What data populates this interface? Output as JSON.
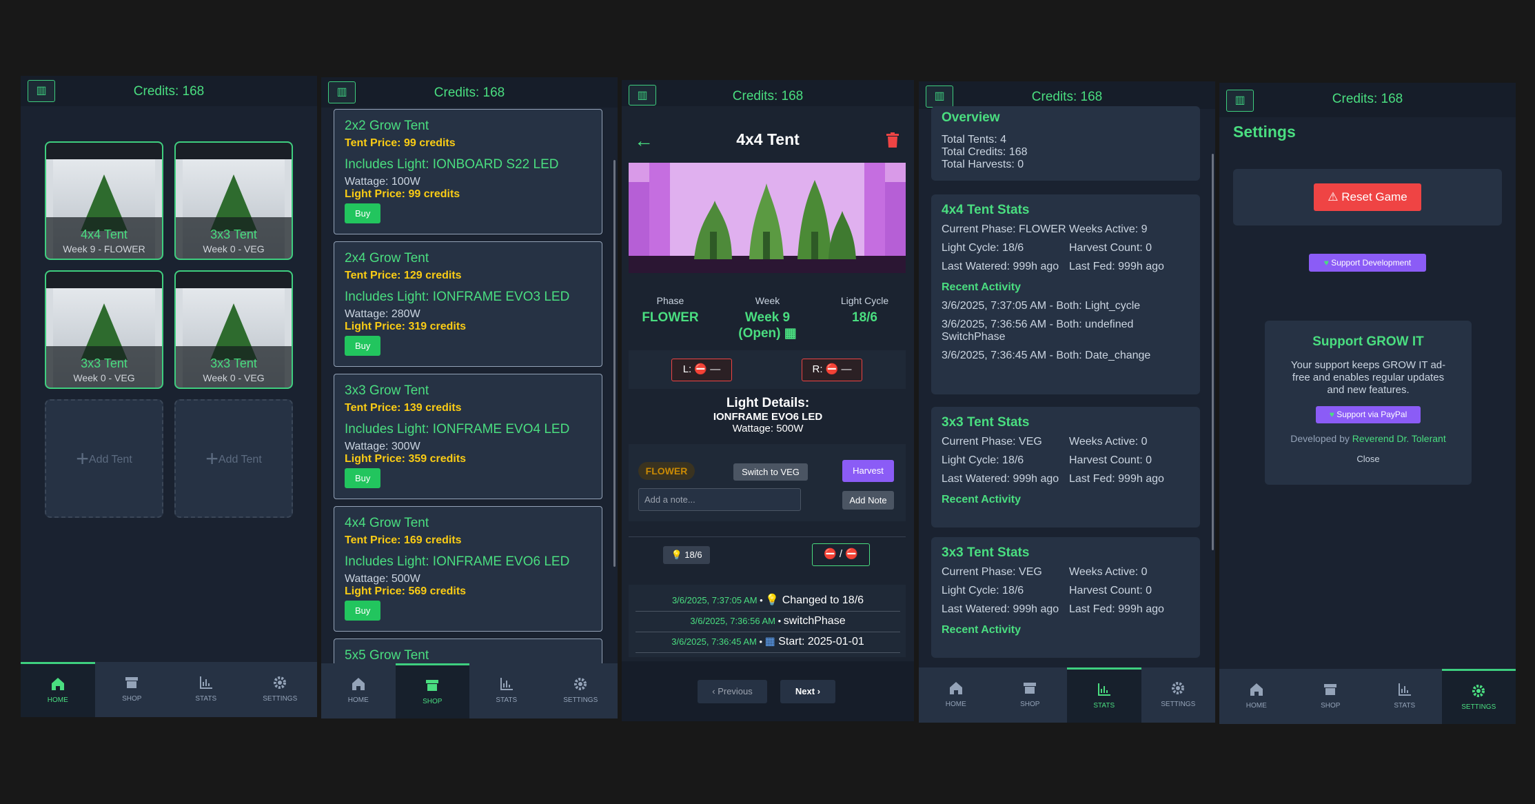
{
  "credits_label": "Credits: 168",
  "nav": {
    "home": "HOME",
    "shop": "SHOP",
    "stats": "STATS",
    "settings": "SETTINGS"
  },
  "home": {
    "tents": [
      {
        "name": "4x4 Tent",
        "sub": "Week 9 - FLOWER"
      },
      {
        "name": "3x3 Tent",
        "sub": "Week 0 - VEG"
      },
      {
        "name": "3x3 Tent",
        "sub": "Week 0 - VEG"
      },
      {
        "name": "3x3 Tent",
        "sub": "Week 0 - VEG"
      }
    ],
    "add_label": "Add Tent"
  },
  "shop": {
    "items": [
      {
        "title": "2x2 Grow Tent",
        "price": "Tent Price: 99 credits",
        "light": "Includes Light: IONBOARD S22 LED",
        "wattage": "Wattage: 100W",
        "light_price": "Light Price: 99 credits",
        "buy": "Buy"
      },
      {
        "title": "2x4 Grow Tent",
        "price": "Tent Price: 129 credits",
        "light": "Includes Light: IONFRAME EVO3 LED",
        "wattage": "Wattage: 280W",
        "light_price": "Light Price: 319 credits",
        "buy": "Buy"
      },
      {
        "title": "3x3 Grow Tent",
        "price": "Tent Price: 139 credits",
        "light": "Includes Light: IONFRAME EVO4 LED",
        "wattage": "Wattage: 300W",
        "light_price": "Light Price: 359 credits",
        "buy": "Buy"
      },
      {
        "title": "4x4 Grow Tent",
        "price": "Tent Price: 169 credits",
        "light": "Includes Light: IONFRAME EVO6 LED",
        "wattage": "Wattage: 500W",
        "light_price": "Light Price: 569 credits",
        "buy": "Buy"
      },
      {
        "title": "5x5 Grow Tent"
      }
    ]
  },
  "detail": {
    "title": "4x4 Tent",
    "phase_label": "Phase",
    "phase_value": "FLOWER",
    "week_label": "Week",
    "week_value": "Week 9",
    "week_open": "(Open)",
    "cycle_label": "Light Cycle",
    "cycle_value": "18/6",
    "left_badge": "L:",
    "left_value": "—",
    "right_badge": "R:",
    "right_value": "—",
    "light_heading": "Light Details:",
    "light_name": "IONFRAME EVO6 LED",
    "light_watt": "Wattage: 500W",
    "phase_chip": "FLOWER",
    "switch_btn": "Switch to VEG",
    "harvest_btn": "Harvest",
    "note_placeholder": "Add a note...",
    "add_note_btn": "Add Note",
    "cycle_chip": "18/6",
    "slash": "/",
    "log": [
      {
        "time": "3/6/2025, 7:37:05 AM",
        "text": "Changed to 18/6"
      },
      {
        "time": "3/6/2025, 7:36:56 AM",
        "text": "switchPhase"
      },
      {
        "time": "3/6/2025, 7:36:45 AM",
        "text": "Start: 2025-01-01"
      }
    ],
    "prev": "Previous",
    "next": "Next"
  },
  "stats": {
    "overview_title": "Overview",
    "total_tents": "Total Tents: 4",
    "total_credits": "Total Credits: 168",
    "total_harvests": "Total Harvests: 0",
    "recent_activity": "Recent Activity",
    "tents": [
      {
        "title": "4x4 Tent Stats",
        "phase": "Current Phase: FLOWER",
        "weeks": "Weeks Active: 9",
        "cycle": "Light Cycle: 18/6",
        "harvests": "Harvest Count: 0",
        "watered": "Last Watered: 999h ago",
        "fed": "Last Fed: 999h ago",
        "activity": [
          "3/6/2025, 7:37:05 AM - Both: Light_cycle",
          "3/6/2025, 7:36:56 AM - Both: undefined SwitchPhase",
          "3/6/2025, 7:36:45 AM - Both: Date_change"
        ]
      },
      {
        "title": "3x3 Tent Stats",
        "phase": "Current Phase: VEG",
        "weeks": "Weeks Active: 0",
        "cycle": "Light Cycle: 18/6",
        "harvests": "Harvest Count: 0",
        "watered": "Last Watered: 999h ago",
        "fed": "Last Fed: 999h ago"
      },
      {
        "title": "3x3 Tent Stats",
        "phase": "Current Phase: VEG",
        "weeks": "Weeks Active: 0",
        "cycle": "Light Cycle: 18/6",
        "harvests": "Harvest Count: 0",
        "watered": "Last Watered: 999h ago",
        "fed": "Last Fed: 999h ago"
      }
    ]
  },
  "settings": {
    "title": "Settings",
    "reset": "Reset Game",
    "support_dev": "Support Development",
    "modal_title": "Support GROW IT",
    "modal_text": "Your support keeps GROW IT ad-free and enables regular updates and new features.",
    "paypal": "Support via PayPal",
    "developed_by": "Developed by",
    "developer": "Reverend Dr. Tolerant",
    "close": "Close"
  },
  "colors": {
    "accent": "#4ade80",
    "price": "#facc15",
    "danger": "#ef4444",
    "purple": "#8b5cf6"
  }
}
